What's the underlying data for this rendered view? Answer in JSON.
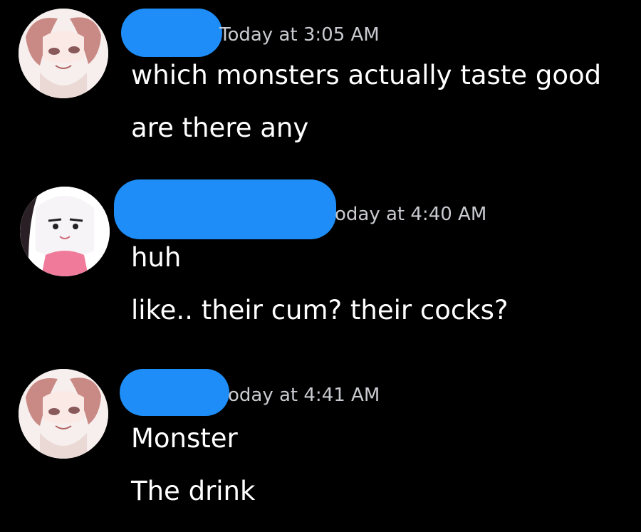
{
  "messages": [
    {
      "author_redacted": true,
      "timestamp": "Today at 3:05 AM",
      "lines": [
        "which monsters actually taste good",
        "are there any"
      ]
    },
    {
      "author_redacted": true,
      "timestamp": "oday at 4:40 AM",
      "lines": [
        "huh",
        "like.. their cum? their cocks?"
      ]
    },
    {
      "author_redacted": true,
      "timestamp": "oday at 4:41 AM",
      "lines": [
        "Monster",
        "The drink"
      ]
    }
  ],
  "colors": {
    "background": "#000000",
    "redaction": "#1e8df7",
    "timestamp": "#c9cbd1",
    "text": "#ffffff"
  },
  "icons": [
    "avatar-anime-girl-1",
    "avatar-anime-girl-2"
  ]
}
